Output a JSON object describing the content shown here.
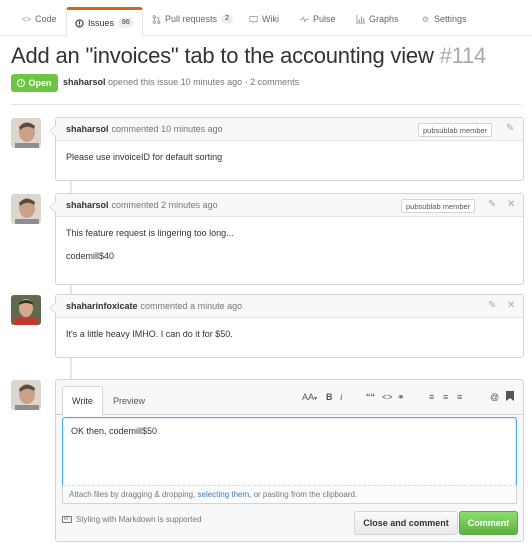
{
  "nav": {
    "tabs": [
      {
        "label": "Code",
        "icon": "code-icon"
      },
      {
        "label": "Issues",
        "icon": "issue-opened-icon",
        "count": "86"
      },
      {
        "label": "Pull requests",
        "icon": "pull-request-icon",
        "count": "2"
      },
      {
        "label": "Wiki",
        "icon": "book-icon"
      },
      {
        "label": "Pulse",
        "icon": "pulse-icon"
      },
      {
        "label": "Graphs",
        "icon": "graph-icon"
      },
      {
        "label": "Settings",
        "icon": "gear-icon"
      }
    ]
  },
  "issue": {
    "title": "Add an \"invoices\" tab to the accounting view",
    "number": "#114",
    "state": "Open",
    "author": "shaharsol",
    "meta_text": "opened this issue 10 minutes ago · 2 comments"
  },
  "comments": [
    {
      "author": "shaharsol",
      "action": "commented",
      "time": "10 minutes ago",
      "badge": "pubsublab member",
      "body": [
        "Please use invoiceID for default sorting"
      ]
    },
    {
      "author": "shaharsol",
      "action": "commented",
      "time": "2 minutes ago",
      "badge": "pubsublab member",
      "body": [
        "This feature request is lingering too long...",
        "codemill$40"
      ]
    },
    {
      "author": "shaharinfoxicate",
      "action": "commented",
      "time": "a minute ago",
      "body": [
        "It's a little heavy IMHO. I can do it for $50."
      ]
    }
  ],
  "editor": {
    "tab_write": "Write",
    "tab_preview": "Preview",
    "toolbar": {
      "header": "AA",
      "bold": "B",
      "italic": "i",
      "quote": "““",
      "code": "<>",
      "link": "⚭",
      "ul": "≡",
      "ol": "≡",
      "tasklist": "≡",
      "mention": "@",
      "saved_reply": "■"
    },
    "value": "OK then, codemill$50",
    "attach_prefix": "Attach files by dragging & dropping,",
    "attach_link": "selecting them",
    "attach_suffix": ", or pasting from the clipboard.",
    "markdown_note": "Styling with Markdown is supported",
    "close_button": "Close and comment",
    "comment_button": "Comment"
  },
  "colors": {
    "accent_tab": "#d26911",
    "open_state": "#6cc644",
    "comment_button": "#60b044",
    "link": "#4078c0",
    "focus": "#51a7e8"
  }
}
